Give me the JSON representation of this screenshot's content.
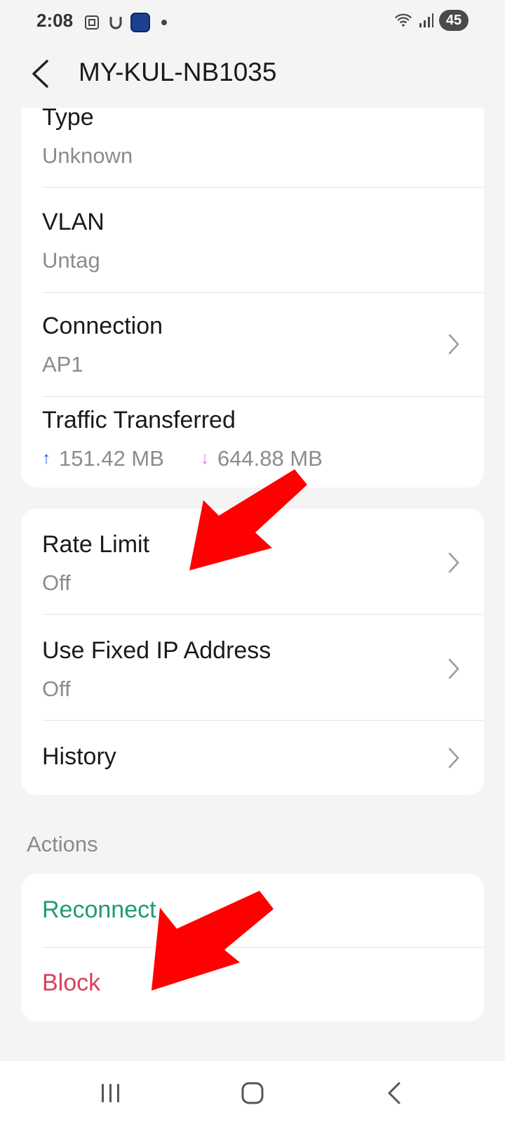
{
  "status_bar": {
    "time": "2:08",
    "battery": "45"
  },
  "header": {
    "title": "MY-KUL-NB1035"
  },
  "details": {
    "type_label": "Type",
    "type_value": "Unknown",
    "vlan_label": "VLAN",
    "vlan_value": "Untag",
    "connection_label": "Connection",
    "connection_value": "AP1",
    "traffic_label": "Traffic Transferred",
    "upload_arrow": "↑",
    "upload_value": "151.42 MB",
    "download_arrow": "↓",
    "download_value": "644.88 MB"
  },
  "settings": {
    "rate_limit_label": "Rate Limit",
    "rate_limit_value": "Off",
    "fixed_ip_label": "Use Fixed IP Address",
    "fixed_ip_value": "Off",
    "history_label": "History"
  },
  "actions": {
    "section_label": "Actions",
    "reconnect_label": "Reconnect",
    "block_label": "Block"
  },
  "colors": {
    "reconnect": "#1f9d6b",
    "block": "#d9405e",
    "annotation_arrow": "#ff0000"
  }
}
